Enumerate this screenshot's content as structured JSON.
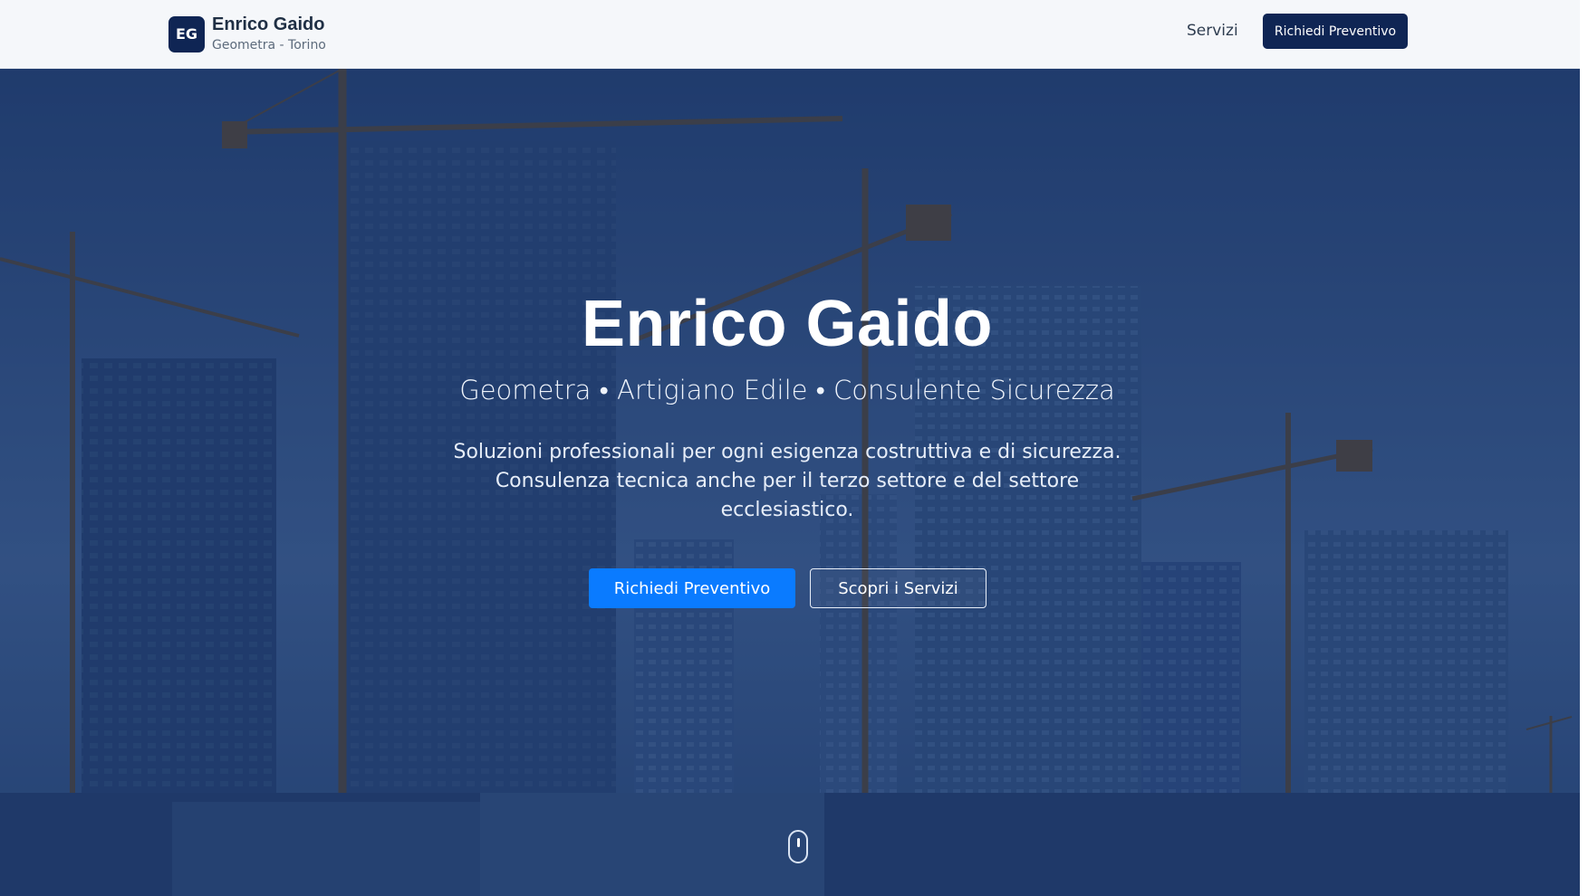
{
  "header": {
    "logo_initials": "EG",
    "brand_name": "Enrico Gaido",
    "brand_subtitle": "Geometra - Torino",
    "nav_services": "Servizi",
    "cta_label": "Richiedi Preventivo"
  },
  "hero": {
    "title": "Enrico Gaido",
    "tagline": "Geometra • Artigiano Edile • Consulente Sicurezza",
    "description": "Soluzioni professionali per ogni esigenza costruttiva e di sicurezza. Consulenza tecnica anche per il terzo settore e del settore ecclesiastico.",
    "primary_button": "Richiedi Preventivo",
    "secondary_button": "Scopri i Servizi",
    "background_image": "construction-cranes-skyscrapers",
    "scroll_icon": "mouse-scroll-icon"
  },
  "colors": {
    "brand_navy": "#0f2554",
    "primary_blue": "#0a7bff",
    "header_bg": "#f5f7fa",
    "overlay": "#112d5f"
  }
}
